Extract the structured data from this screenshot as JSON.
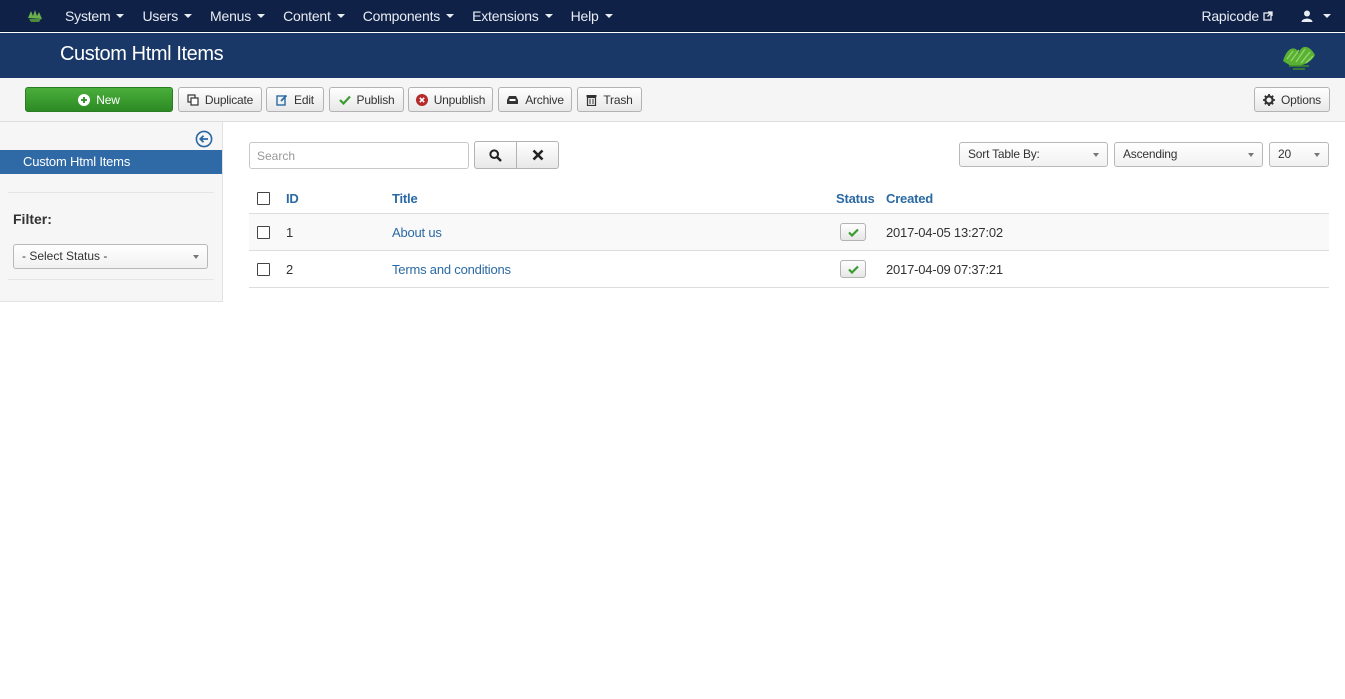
{
  "nav": {
    "menu": [
      "System",
      "Users",
      "Menus",
      "Content",
      "Components",
      "Extensions",
      "Help"
    ],
    "site_name": "Rapicode"
  },
  "header": {
    "title": "Custom Html Items"
  },
  "toolbar": {
    "new": "New",
    "duplicate": "Duplicate",
    "edit": "Edit",
    "publish": "Publish",
    "unpublish": "Unpublish",
    "archive": "Archive",
    "trash": "Trash",
    "options": "Options"
  },
  "sidebar": {
    "item": "Custom Html Items",
    "filter_label": "Filter:",
    "status_select": "- Select Status -"
  },
  "search": {
    "placeholder": "Search"
  },
  "sorting": {
    "sort_by": "Sort Table By:",
    "direction": "Ascending",
    "limit": "20"
  },
  "table": {
    "headers": {
      "id": "ID",
      "title": "Title",
      "status": "Status",
      "created": "Created"
    },
    "rows": [
      {
        "id": "1",
        "title": "About us",
        "published": true,
        "created": "2017-04-05 13:27:02"
      },
      {
        "id": "2",
        "title": "Terms and conditions",
        "published": true,
        "created": "2017-04-09 07:37:21"
      }
    ]
  },
  "colors": {
    "navbar": "#0f2147",
    "header": "#1a3867",
    "accent": "#2f6aa6",
    "new_button": "#3a9c2f",
    "link": "#2a69a3"
  }
}
